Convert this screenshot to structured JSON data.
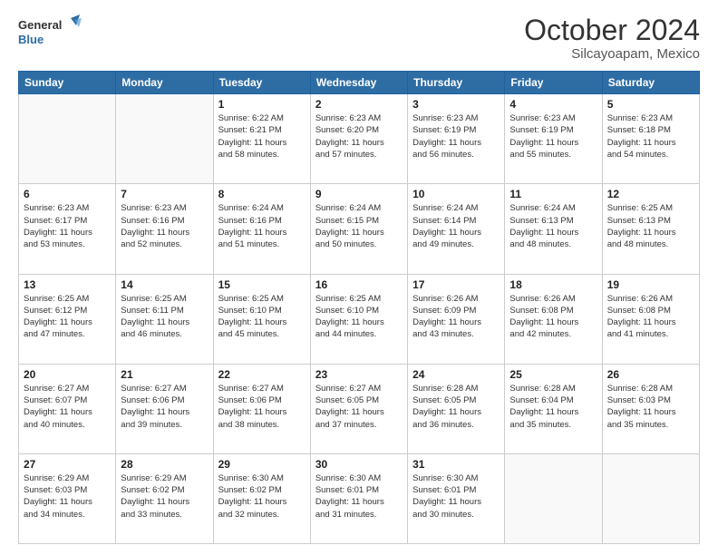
{
  "header": {
    "logo_general": "General",
    "logo_blue": "Blue",
    "title": "October 2024",
    "subtitle": "Silcayoapam, Mexico"
  },
  "weekdays": [
    "Sunday",
    "Monday",
    "Tuesday",
    "Wednesday",
    "Thursday",
    "Friday",
    "Saturday"
  ],
  "weeks": [
    [
      {
        "day": "",
        "info": ""
      },
      {
        "day": "",
        "info": ""
      },
      {
        "day": "1",
        "info": "Sunrise: 6:22 AM\nSunset: 6:21 PM\nDaylight: 11 hours\nand 58 minutes."
      },
      {
        "day": "2",
        "info": "Sunrise: 6:23 AM\nSunset: 6:20 PM\nDaylight: 11 hours\nand 57 minutes."
      },
      {
        "day": "3",
        "info": "Sunrise: 6:23 AM\nSunset: 6:19 PM\nDaylight: 11 hours\nand 56 minutes."
      },
      {
        "day": "4",
        "info": "Sunrise: 6:23 AM\nSunset: 6:19 PM\nDaylight: 11 hours\nand 55 minutes."
      },
      {
        "day": "5",
        "info": "Sunrise: 6:23 AM\nSunset: 6:18 PM\nDaylight: 11 hours\nand 54 minutes."
      }
    ],
    [
      {
        "day": "6",
        "info": "Sunrise: 6:23 AM\nSunset: 6:17 PM\nDaylight: 11 hours\nand 53 minutes."
      },
      {
        "day": "7",
        "info": "Sunrise: 6:23 AM\nSunset: 6:16 PM\nDaylight: 11 hours\nand 52 minutes."
      },
      {
        "day": "8",
        "info": "Sunrise: 6:24 AM\nSunset: 6:16 PM\nDaylight: 11 hours\nand 51 minutes."
      },
      {
        "day": "9",
        "info": "Sunrise: 6:24 AM\nSunset: 6:15 PM\nDaylight: 11 hours\nand 50 minutes."
      },
      {
        "day": "10",
        "info": "Sunrise: 6:24 AM\nSunset: 6:14 PM\nDaylight: 11 hours\nand 49 minutes."
      },
      {
        "day": "11",
        "info": "Sunrise: 6:24 AM\nSunset: 6:13 PM\nDaylight: 11 hours\nand 48 minutes."
      },
      {
        "day": "12",
        "info": "Sunrise: 6:25 AM\nSunset: 6:13 PM\nDaylight: 11 hours\nand 48 minutes."
      }
    ],
    [
      {
        "day": "13",
        "info": "Sunrise: 6:25 AM\nSunset: 6:12 PM\nDaylight: 11 hours\nand 47 minutes."
      },
      {
        "day": "14",
        "info": "Sunrise: 6:25 AM\nSunset: 6:11 PM\nDaylight: 11 hours\nand 46 minutes."
      },
      {
        "day": "15",
        "info": "Sunrise: 6:25 AM\nSunset: 6:10 PM\nDaylight: 11 hours\nand 45 minutes."
      },
      {
        "day": "16",
        "info": "Sunrise: 6:25 AM\nSunset: 6:10 PM\nDaylight: 11 hours\nand 44 minutes."
      },
      {
        "day": "17",
        "info": "Sunrise: 6:26 AM\nSunset: 6:09 PM\nDaylight: 11 hours\nand 43 minutes."
      },
      {
        "day": "18",
        "info": "Sunrise: 6:26 AM\nSunset: 6:08 PM\nDaylight: 11 hours\nand 42 minutes."
      },
      {
        "day": "19",
        "info": "Sunrise: 6:26 AM\nSunset: 6:08 PM\nDaylight: 11 hours\nand 41 minutes."
      }
    ],
    [
      {
        "day": "20",
        "info": "Sunrise: 6:27 AM\nSunset: 6:07 PM\nDaylight: 11 hours\nand 40 minutes."
      },
      {
        "day": "21",
        "info": "Sunrise: 6:27 AM\nSunset: 6:06 PM\nDaylight: 11 hours\nand 39 minutes."
      },
      {
        "day": "22",
        "info": "Sunrise: 6:27 AM\nSunset: 6:06 PM\nDaylight: 11 hours\nand 38 minutes."
      },
      {
        "day": "23",
        "info": "Sunrise: 6:27 AM\nSunset: 6:05 PM\nDaylight: 11 hours\nand 37 minutes."
      },
      {
        "day": "24",
        "info": "Sunrise: 6:28 AM\nSunset: 6:05 PM\nDaylight: 11 hours\nand 36 minutes."
      },
      {
        "day": "25",
        "info": "Sunrise: 6:28 AM\nSunset: 6:04 PM\nDaylight: 11 hours\nand 35 minutes."
      },
      {
        "day": "26",
        "info": "Sunrise: 6:28 AM\nSunset: 6:03 PM\nDaylight: 11 hours\nand 35 minutes."
      }
    ],
    [
      {
        "day": "27",
        "info": "Sunrise: 6:29 AM\nSunset: 6:03 PM\nDaylight: 11 hours\nand 34 minutes."
      },
      {
        "day": "28",
        "info": "Sunrise: 6:29 AM\nSunset: 6:02 PM\nDaylight: 11 hours\nand 33 minutes."
      },
      {
        "day": "29",
        "info": "Sunrise: 6:30 AM\nSunset: 6:02 PM\nDaylight: 11 hours\nand 32 minutes."
      },
      {
        "day": "30",
        "info": "Sunrise: 6:30 AM\nSunset: 6:01 PM\nDaylight: 11 hours\nand 31 minutes."
      },
      {
        "day": "31",
        "info": "Sunrise: 6:30 AM\nSunset: 6:01 PM\nDaylight: 11 hours\nand 30 minutes."
      },
      {
        "day": "",
        "info": ""
      },
      {
        "day": "",
        "info": ""
      }
    ]
  ]
}
